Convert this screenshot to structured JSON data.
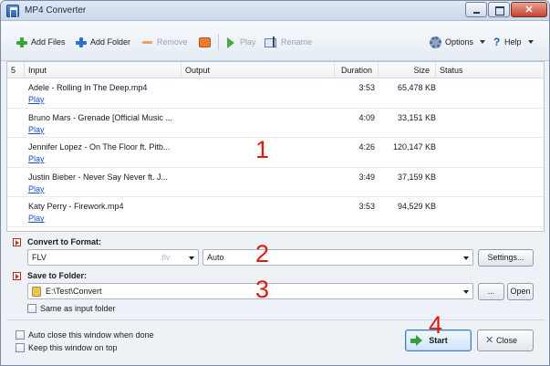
{
  "window": {
    "title": "MP4 Converter",
    "close_glyph": "✕"
  },
  "toolbar": {
    "add_files": "Add Files",
    "add_folder": "Add Folder",
    "remove": "Remove",
    "play": "Play",
    "rename": "Rename",
    "options": "Options",
    "help": "Help"
  },
  "file_list": {
    "count": "5",
    "columns": {
      "input": "Input",
      "output": "Output",
      "duration": "Duration",
      "size": "Size",
      "status": "Status"
    },
    "play_link": "Play",
    "rows": [
      {
        "name": "Adele - Rolling In The Deep.mp4",
        "duration": "3:53",
        "size": "65,478 KB"
      },
      {
        "name": "Bruno Mars - Grenade [Official Music ...",
        "duration": "4:09",
        "size": "33,151 KB"
      },
      {
        "name": "Jennifer Lopez - On The Floor ft. Pitb...",
        "duration": "4:26",
        "size": "120,147 KB"
      },
      {
        "name": "Justin Bieber - Never Say Never ft. J...",
        "duration": "3:49",
        "size": "37,159 KB"
      },
      {
        "name": "Katy Perry - Firework.mp4",
        "duration": "3:53",
        "size": "94,529 KB"
      }
    ]
  },
  "convert": {
    "label": "Convert to Format:",
    "format": "FLV",
    "format_ext": ".flv",
    "preset": "Auto",
    "settings_button": "Settings..."
  },
  "save": {
    "label": "Save to Folder:",
    "path": "E:\\Test\\Convert",
    "browse_button": "...",
    "open_button": "Open",
    "same_as_input": "Same as input folder"
  },
  "footer": {
    "auto_close": "Auto close this window when done",
    "keep_on_top": "Keep this window on top",
    "start_button": "Start",
    "close_button": "Close"
  },
  "annotations": [
    "1",
    "2",
    "3",
    "4"
  ],
  "colors": {
    "accent": "#1c4fc4",
    "annotation": "#e01a12",
    "start_arrow": "#2fa33a"
  }
}
